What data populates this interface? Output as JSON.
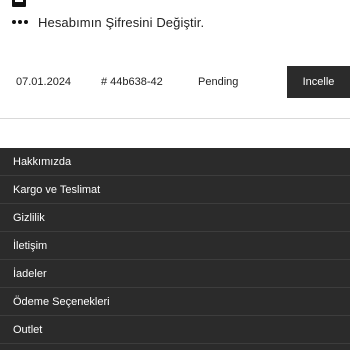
{
  "account": {
    "change_password_label": "Hesabımın Şifresini Değiştir."
  },
  "orders": {
    "rows": [
      {
        "date": "07.01.2024",
        "id": "# 44b638-42",
        "status": "Pending",
        "action_label": "Incelle"
      }
    ]
  },
  "footer": {
    "items": [
      "Hakkımızda",
      "Kargo ve Teslimat",
      "Gizlilik",
      "İletişim",
      "İadeler",
      "Ödeme Seçenekleri",
      "Outlet"
    ]
  },
  "colors": {
    "dark": "#2b2b2b",
    "text": "#222222",
    "background": "#ffffff"
  },
  "icons": {
    "top_row": "account-icon",
    "password_row": "password-dots-icon"
  }
}
